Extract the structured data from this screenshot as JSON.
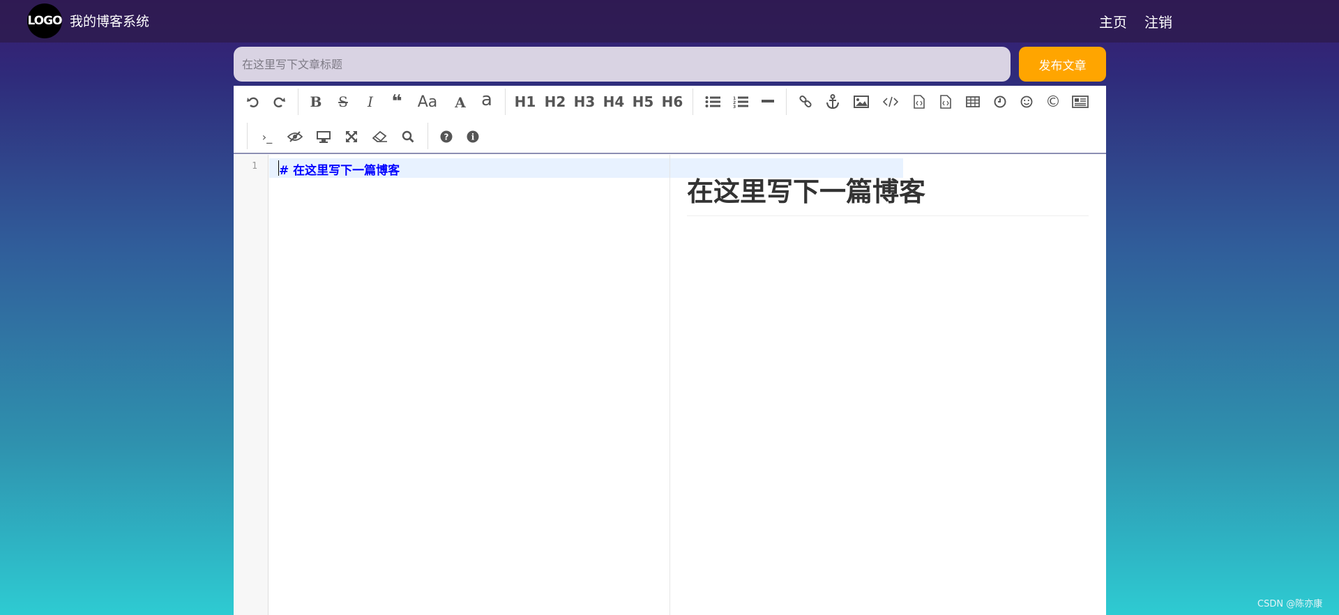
{
  "header": {
    "logo_text": "LOGO",
    "site_title": "我的博客系统",
    "nav": [
      {
        "label": "主页"
      },
      {
        "label": "注销"
      }
    ]
  },
  "editor_form": {
    "title_placeholder": "在这里写下文章标题",
    "title_value": "",
    "publish_label": "发布文章"
  },
  "toolbar": {
    "row1": [
      {
        "icon": "undo-icon"
      },
      {
        "icon": "redo-icon"
      },
      {
        "label": "B",
        "icon": "bold-icon"
      },
      {
        "label": "S",
        "icon": "strikethrough-icon"
      },
      {
        "label": "I",
        "icon": "italic-icon"
      },
      {
        "label": "❝",
        "icon": "quote-icon"
      },
      {
        "label": "Aa",
        "icon": "uppercase-icon"
      },
      {
        "label": "A",
        "icon": "uppercase-a-icon"
      },
      {
        "label": "a",
        "icon": "lowercase-icon"
      },
      {
        "label": "H1"
      },
      {
        "label": "H2"
      },
      {
        "label": "H3"
      },
      {
        "label": "H4"
      },
      {
        "label": "H5"
      },
      {
        "label": "H6"
      },
      {
        "icon": "unordered-list-icon"
      },
      {
        "icon": "ordered-list-icon"
      },
      {
        "icon": "horizontal-rule-icon"
      },
      {
        "icon": "link-icon"
      },
      {
        "icon": "anchor-icon"
      },
      {
        "icon": "image-icon"
      },
      {
        "icon": "code-icon"
      },
      {
        "icon": "code-block-icon"
      },
      {
        "icon": "preformatted-icon"
      },
      {
        "icon": "table-icon"
      },
      {
        "icon": "datetime-icon"
      },
      {
        "icon": "emoji-icon"
      },
      {
        "label": "©",
        "icon": "html-entities-icon"
      },
      {
        "icon": "pagebreak-icon"
      }
    ],
    "row2": [
      {
        "label": "›_",
        "icon": "terminal-icon"
      },
      {
        "icon": "eye-slash-icon"
      },
      {
        "icon": "desktop-icon"
      },
      {
        "icon": "fullscreen-icon"
      },
      {
        "icon": "eraser-icon"
      },
      {
        "icon": "search-icon"
      },
      {
        "label": "?",
        "icon": "help-icon"
      },
      {
        "label": "i",
        "icon": "info-icon"
      }
    ]
  },
  "code": {
    "line_number": "1",
    "line_text": "#  在这里写下一篇博客"
  },
  "preview": {
    "h1": "在这里写下一篇博客"
  },
  "watermark": "CSDN @陈亦康",
  "colors": {
    "publish": "#ffa500",
    "code_heading": "#0000ff"
  }
}
